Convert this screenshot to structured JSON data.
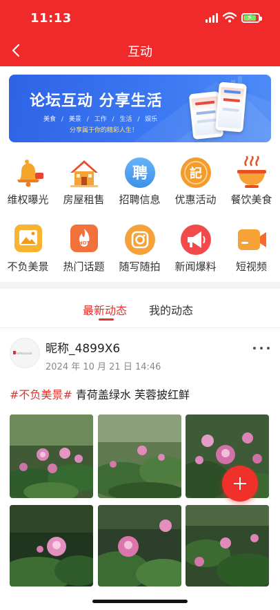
{
  "status_bar": {
    "time": "11:13"
  },
  "nav": {
    "title": "互动"
  },
  "banner": {
    "title": "论坛互动  分享生活",
    "tags": [
      "美食",
      "/",
      "美景",
      "/",
      "工作",
      "/",
      "生活",
      "/",
      "娱乐"
    ],
    "subtitle": "分享属于你的精彩人生！"
  },
  "grid": {
    "row1": [
      {
        "label": "维权曝光",
        "icon": "bell-icon"
      },
      {
        "label": "房屋租售",
        "icon": "house-icon"
      },
      {
        "label": "招聘信息",
        "icon": "recruit-icon",
        "glyph": "聘"
      },
      {
        "label": "优惠活动",
        "icon": "coupon-icon",
        "glyph": "記"
      },
      {
        "label": "餐饮美食",
        "icon": "food-bowl-icon"
      }
    ],
    "row2": [
      {
        "label": "不负美景",
        "icon": "landscape-icon"
      },
      {
        "label": "热门话题",
        "icon": "hot-topic-icon",
        "glyph": "HOT"
      },
      {
        "label": "随写随拍",
        "icon": "camera-icon"
      },
      {
        "label": "新闻爆料",
        "icon": "megaphone-icon"
      },
      {
        "label": "短视频",
        "icon": "video-icon"
      }
    ]
  },
  "tabs": {
    "latest": "最新动态",
    "mine": "我的动态"
  },
  "post": {
    "nickname": "昵称_4899X6",
    "date": "2024 年 10 月 21 日  14:46",
    "hashtag": "#不负美景#",
    "text": " 青荷盖绿水 芙蓉披红鲜",
    "avatar_text": "Professional",
    "photos": [
      "lotus-photo-1",
      "lotus-photo-2",
      "lotus-photo-3",
      "lotus-photo-4",
      "lotus-photo-5",
      "lotus-photo-6"
    ]
  },
  "colors": {
    "brand_red": "#f02a2a",
    "accent": "#e5322d",
    "banner_blue": "#3b78f2"
  }
}
